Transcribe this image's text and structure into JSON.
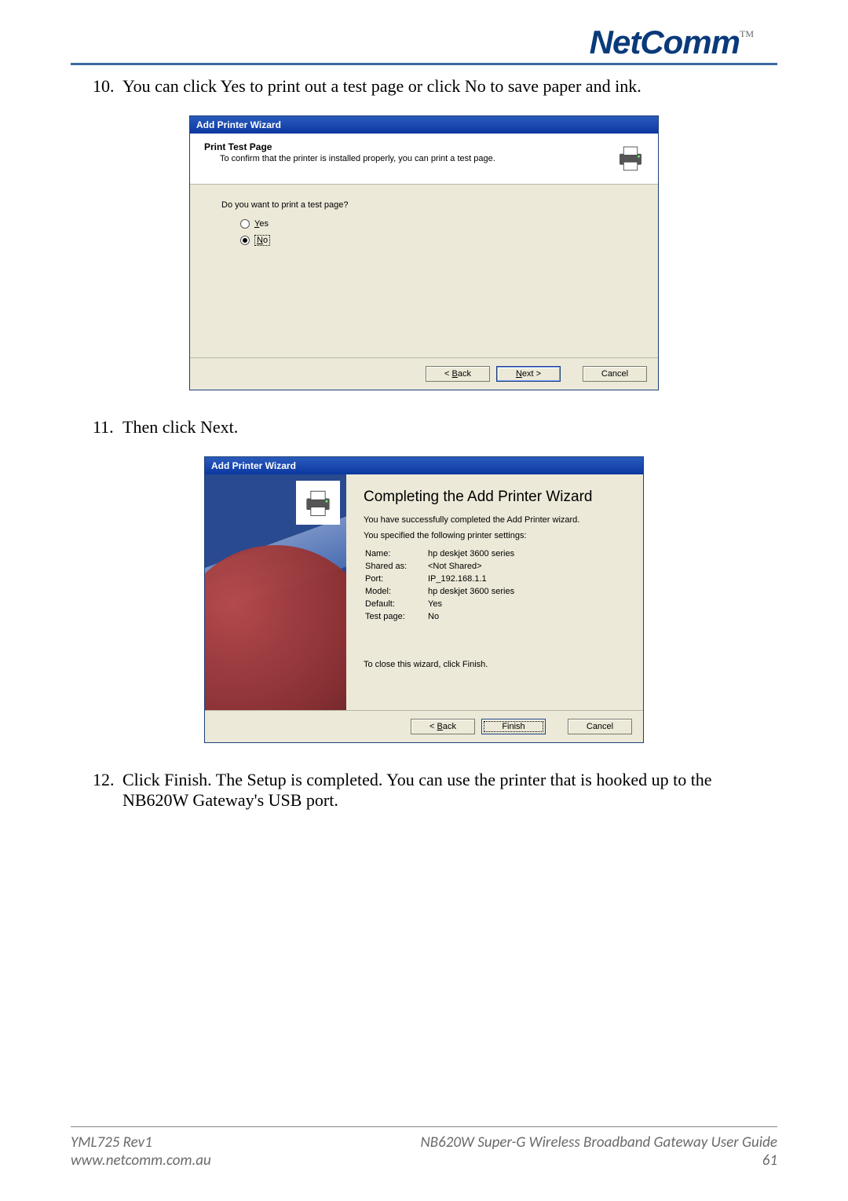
{
  "brand": "NetComm",
  "trademark": "TM",
  "steps": {
    "s10": {
      "num": "10.",
      "text": "You can click Yes to print out a test page or click No to save paper and ink."
    },
    "s11": {
      "num": "11.",
      "text": "Then click Next."
    },
    "s12": {
      "num": "12.",
      "text": "Click Finish. The Setup is completed. You can use the printer that is hooked up to the NB620W Gateway's USB port."
    }
  },
  "wiz1": {
    "title": "Add Printer Wizard",
    "header_title": "Print Test Page",
    "header_sub": "To confirm that the printer is installed properly, you can print a test page.",
    "question": "Do you want to print a test page?",
    "opt_yes_u": "Y",
    "opt_yes_rest": "es",
    "opt_no_u": "N",
    "opt_no_rest": "o",
    "back_pre": "< ",
    "back_u": "B",
    "back_rest": "ack",
    "next_u": "N",
    "next_rest": "ext >",
    "cancel": "Cancel"
  },
  "wiz2": {
    "title": "Add Printer Wizard",
    "rp_title": "Completing the Add Printer Wizard",
    "line1": "You have successfully completed the Add Printer wizard.",
    "line2": "You specified the following printer settings:",
    "settings": {
      "name_lbl": "Name:",
      "name_val": "hp deskjet 3600 series",
      "shared_lbl": "Shared as:",
      "shared_val": "<Not Shared>",
      "port_lbl": "Port:",
      "port_val": "IP_192.168.1.1",
      "model_lbl": "Model:",
      "model_val": "hp deskjet 3600 series",
      "default_lbl": "Default:",
      "default_val": "Yes",
      "test_lbl": "Test page:",
      "test_val": "No"
    },
    "close_hint": "To close this wizard, click Finish.",
    "back_pre": "< ",
    "back_u": "B",
    "back_rest": "ack",
    "finish": "Finish",
    "cancel": "Cancel"
  },
  "footer": {
    "left1": "YML725 Rev1",
    "left2": "www.netcomm.com.au",
    "right1": "NB620W Super-G Wireless Broadband  Gateway User Guide",
    "page": "61"
  }
}
